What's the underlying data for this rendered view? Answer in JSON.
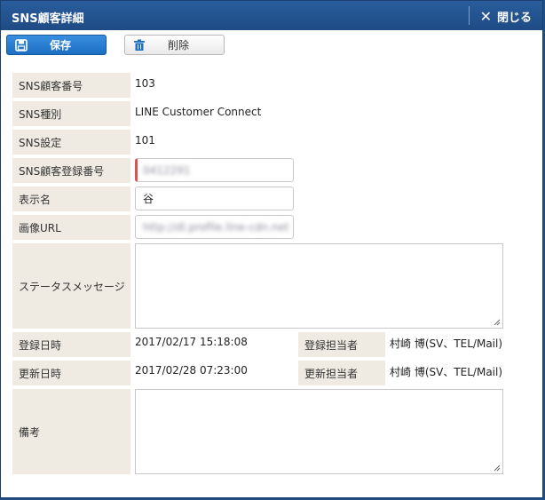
{
  "window": {
    "title": "SNS顧客詳細",
    "close_label": "閉じる"
  },
  "toolbar": {
    "save_label": "保存",
    "delete_label": "削除"
  },
  "fields": {
    "sns_customer_number": {
      "label": "SNS顧客番号",
      "value": "103"
    },
    "sns_type": {
      "label": "SNS種別",
      "value": "LINE Customer Connect"
    },
    "sns_setting": {
      "label": "SNS設定",
      "value": "101"
    },
    "sns_registration_number": {
      "label": "SNS顧客登録番号",
      "value": "0412291"
    },
    "display_name": {
      "label": "表示名",
      "value": "谷"
    },
    "image_url": {
      "label": "画像URL",
      "value": "http://dl.profile.line-cdn.net"
    },
    "status_message": {
      "label": "ステータスメッセージ",
      "value": ""
    },
    "registered_at": {
      "label": "登録日時",
      "value": "2017/02/17 15:18:08"
    },
    "registered_by": {
      "label": "登録担当者",
      "value": "村崎 博(SV、TEL/Mail)"
    },
    "updated_at": {
      "label": "更新日時",
      "value": "2017/02/28 07:23:00"
    },
    "updated_by": {
      "label": "更新担当者",
      "value": "村崎 博(SV、TEL/Mail)"
    },
    "notes": {
      "label": "備考",
      "value": ""
    }
  },
  "icons": {
    "save": "floppy-disk-icon",
    "delete": "trash-icon",
    "close": "close-x-icon"
  },
  "colors": {
    "titlebar": "#1e4b84",
    "save_button": "#1c6fc3",
    "label_bg": "#efebe2",
    "required_marker": "#d9534f"
  }
}
